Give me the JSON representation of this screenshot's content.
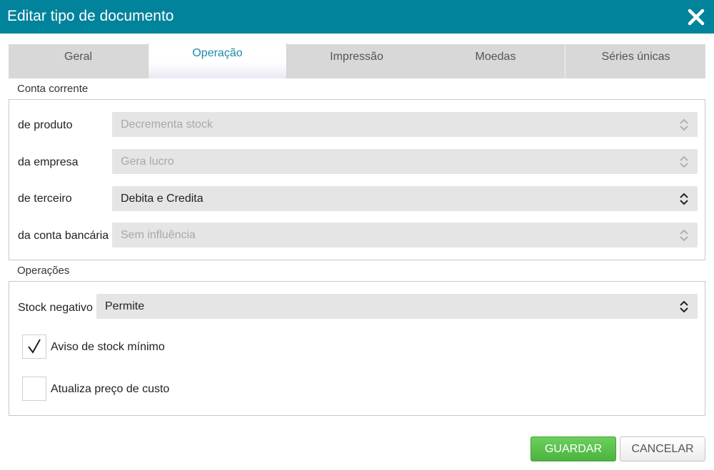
{
  "dialog": {
    "title": "Editar tipo de documento",
    "close_icon": "close-icon"
  },
  "tabs": [
    {
      "label": "Geral",
      "active": false
    },
    {
      "label": "Operação",
      "active": true
    },
    {
      "label": "Impressão",
      "active": false
    },
    {
      "label": "Moedas",
      "active": false
    },
    {
      "label": "Séries únicas",
      "active": false
    }
  ],
  "conta_corrente": {
    "label": "Conta corrente",
    "rows": [
      {
        "label": "de produto",
        "value": "Decrementa stock",
        "disabled": true
      },
      {
        "label": "da empresa",
        "value": "Gera lucro",
        "disabled": true
      },
      {
        "label": "de terceiro",
        "value": "Debita e Credita",
        "disabled": false
      },
      {
        "label": "da conta bancária",
        "value": "Sem influência",
        "disabled": true
      }
    ]
  },
  "operacoes": {
    "label": "Operações",
    "stock_negativo": {
      "label": "Stock negativo",
      "value": "Permite"
    },
    "checkboxes": [
      {
        "label": "Aviso de stock mínimo",
        "checked": true
      },
      {
        "label": "Atualiza preço de custo",
        "checked": false
      }
    ]
  },
  "buttons": {
    "save": "GUARDAR",
    "cancel": "CANCELAR"
  },
  "colors": {
    "titlebar": "#00839b",
    "active_tab_text": "#1a8aa9",
    "save_button": "#5cc04f"
  }
}
